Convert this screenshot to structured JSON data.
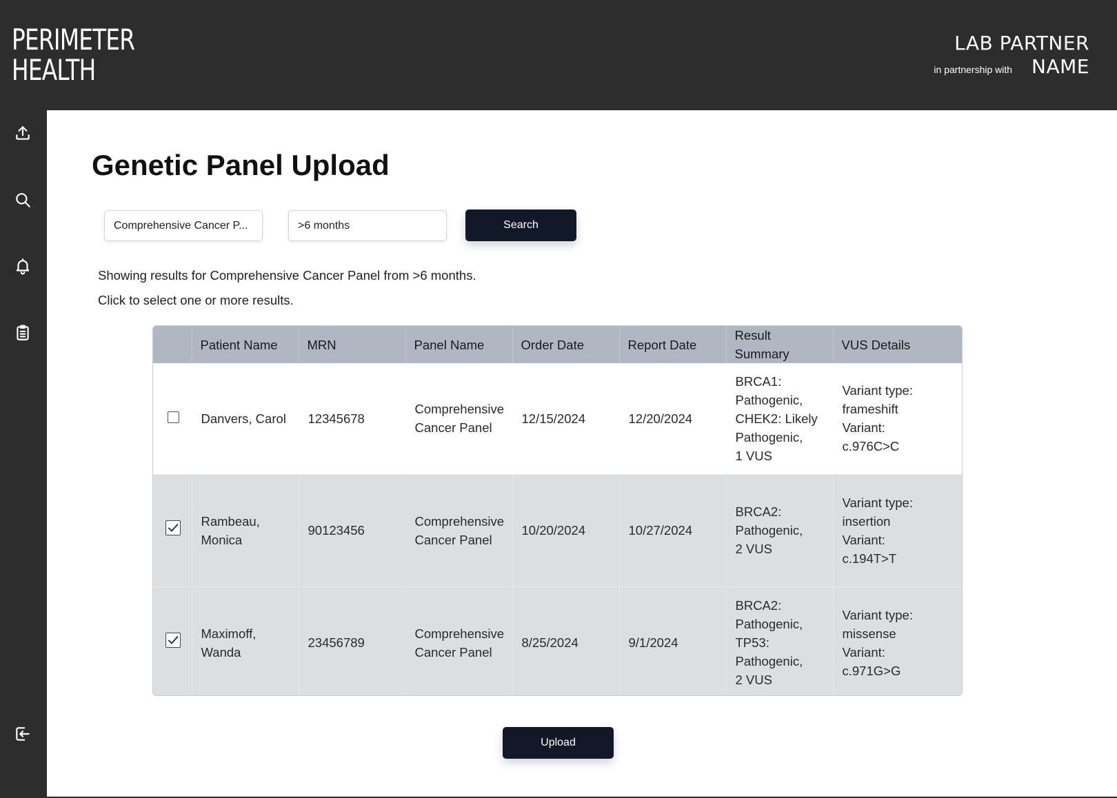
{
  "brand": {
    "line1": "PERIMETER",
    "line2": "HEALTH"
  },
  "partner": {
    "line1": "LAB PARTNER",
    "prefix": "in partnership with",
    "line2": "NAME"
  },
  "sidebar": {
    "items": [
      {
        "icon": "upload-icon"
      },
      {
        "icon": "search-icon"
      },
      {
        "icon": "bell-icon"
      },
      {
        "icon": "clipboard-icon"
      },
      {
        "icon": "logout-icon"
      }
    ]
  },
  "page": {
    "title": "Genetic Panel Upload"
  },
  "filters": {
    "panel_value": "Comprehensive Cancer P...",
    "range_value": ">6 months",
    "search_label": "Search"
  },
  "info": {
    "results_text": "Showing results for Comprehensive Cancer Panel from >6 months.",
    "hint_text": "Click to select one or more results."
  },
  "table": {
    "headers": [
      "Patient Name",
      "MRN",
      "Panel Name",
      "Order Date",
      "Report Date",
      "Result\nSummary",
      "VUS Details"
    ],
    "rows": [
      {
        "checked": false,
        "patient": "Danvers, Carol",
        "mrn": "12345678",
        "panel": "Comprehensive\nCancer Panel",
        "order_date": "12/15/2024",
        "report_date": "12/20/2024",
        "summary": "BRCA1:\nPathogenic,\nCHEK2: Likely\nPathogenic,\n1 VUS",
        "vus": "Variant type:\nframeshift\nVariant:\nc.976C>C"
      },
      {
        "checked": true,
        "patient": "Rambeau,\nMonica",
        "mrn": "90123456",
        "panel": "Comprehensive\nCancer Panel",
        "order_date": "10/20/2024",
        "report_date": "10/27/2024",
        "summary": "BRCA2:\nPathogenic,\n2 VUS",
        "vus": "Variant type:\ninsertion\nVariant:\nc.194T>T"
      },
      {
        "checked": true,
        "patient": "Maximoff,\nWanda",
        "mrn": "23456789",
        "panel": "Comprehensive\nCancer Panel",
        "order_date": "8/25/2024",
        "report_date": "9/1/2024",
        "summary": "BRCA2:\nPathogenic,\nTP53:\nPathogenic,\n2 VUS",
        "vus": "Variant type:\nmissense\nVariant:\nc.971G>G"
      }
    ]
  },
  "actions": {
    "upload_label": "Upload"
  },
  "colors": {
    "chrome": "#2d2d2d",
    "header_row": "#b0b7c2",
    "selected_row": "#dddee0",
    "button": "#111827"
  }
}
